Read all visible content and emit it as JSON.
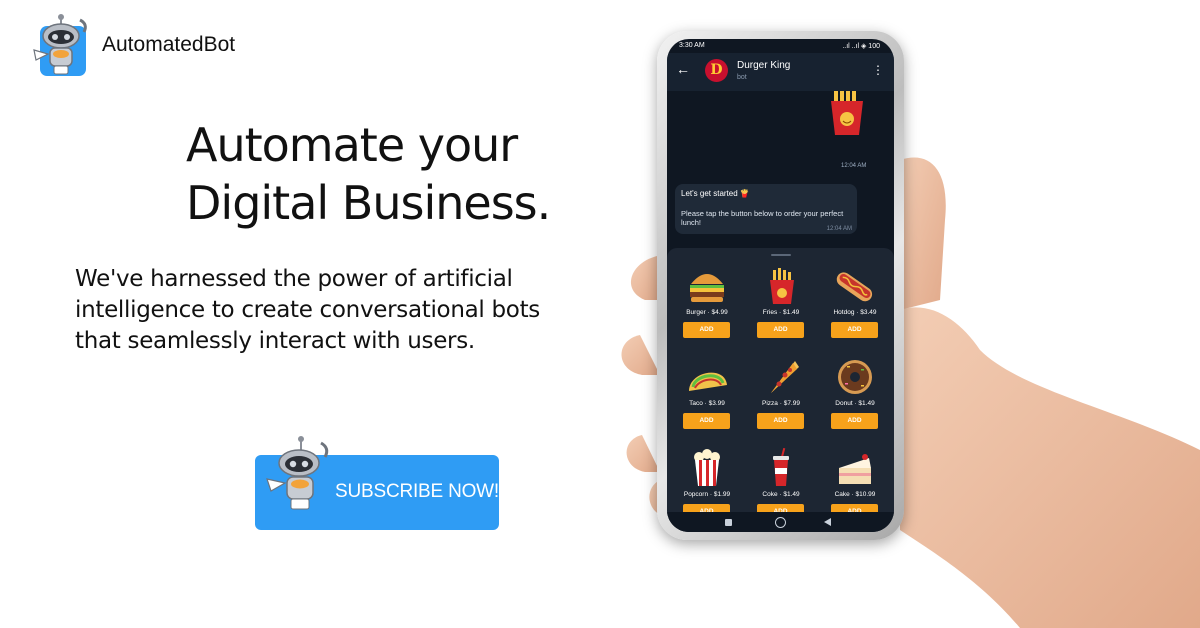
{
  "brand": {
    "name": "AutomatedBot",
    "logo_icon": "robot-logo-icon",
    "accent": "#2f9cf4"
  },
  "hero": {
    "headline_lines": [
      "Automate your",
      "Digital Business."
    ],
    "subcopy_lines": [
      "We've harnessed the power of artificial",
      "intelligence to create conversational bots",
      "that seamlessly interact with users."
    ]
  },
  "cta": {
    "label": "SUBSCRIBE NOW!",
    "icon": "robot-icon",
    "color": "#2f9cf4"
  },
  "phone": {
    "status": {
      "time": "3:30 AM",
      "right": "..ıl ..ıl ◈ 100"
    },
    "chat": {
      "title": "Durger King",
      "subtitle": "bot",
      "avatar_letter": "D",
      "sticker_time": "12:04 AM",
      "message": {
        "title": "Let's get started 🍟",
        "text": "Please tap the button below to order your perfect lunch!",
        "time": "12:04 AM"
      }
    },
    "menu": {
      "add_label": "ADD",
      "items": [
        {
          "label": "Burger · $4.99",
          "icon": "burger-icon"
        },
        {
          "label": "Fries · $1.49",
          "icon": "fries-icon"
        },
        {
          "label": "Hotdog · $3.49",
          "icon": "hotdog-icon"
        },
        {
          "label": "Taco · $3.99",
          "icon": "taco-icon"
        },
        {
          "label": "Pizza · $7.99",
          "icon": "pizza-icon"
        },
        {
          "label": "Donut · $1.49",
          "icon": "donut-icon"
        },
        {
          "label": "Popcorn · $1.99",
          "icon": "popcorn-icon"
        },
        {
          "label": "Coke · $1.49",
          "icon": "coke-icon"
        },
        {
          "label": "Cake · $10.99",
          "icon": "cake-icon"
        }
      ]
    },
    "accent": "#f7a21b"
  }
}
